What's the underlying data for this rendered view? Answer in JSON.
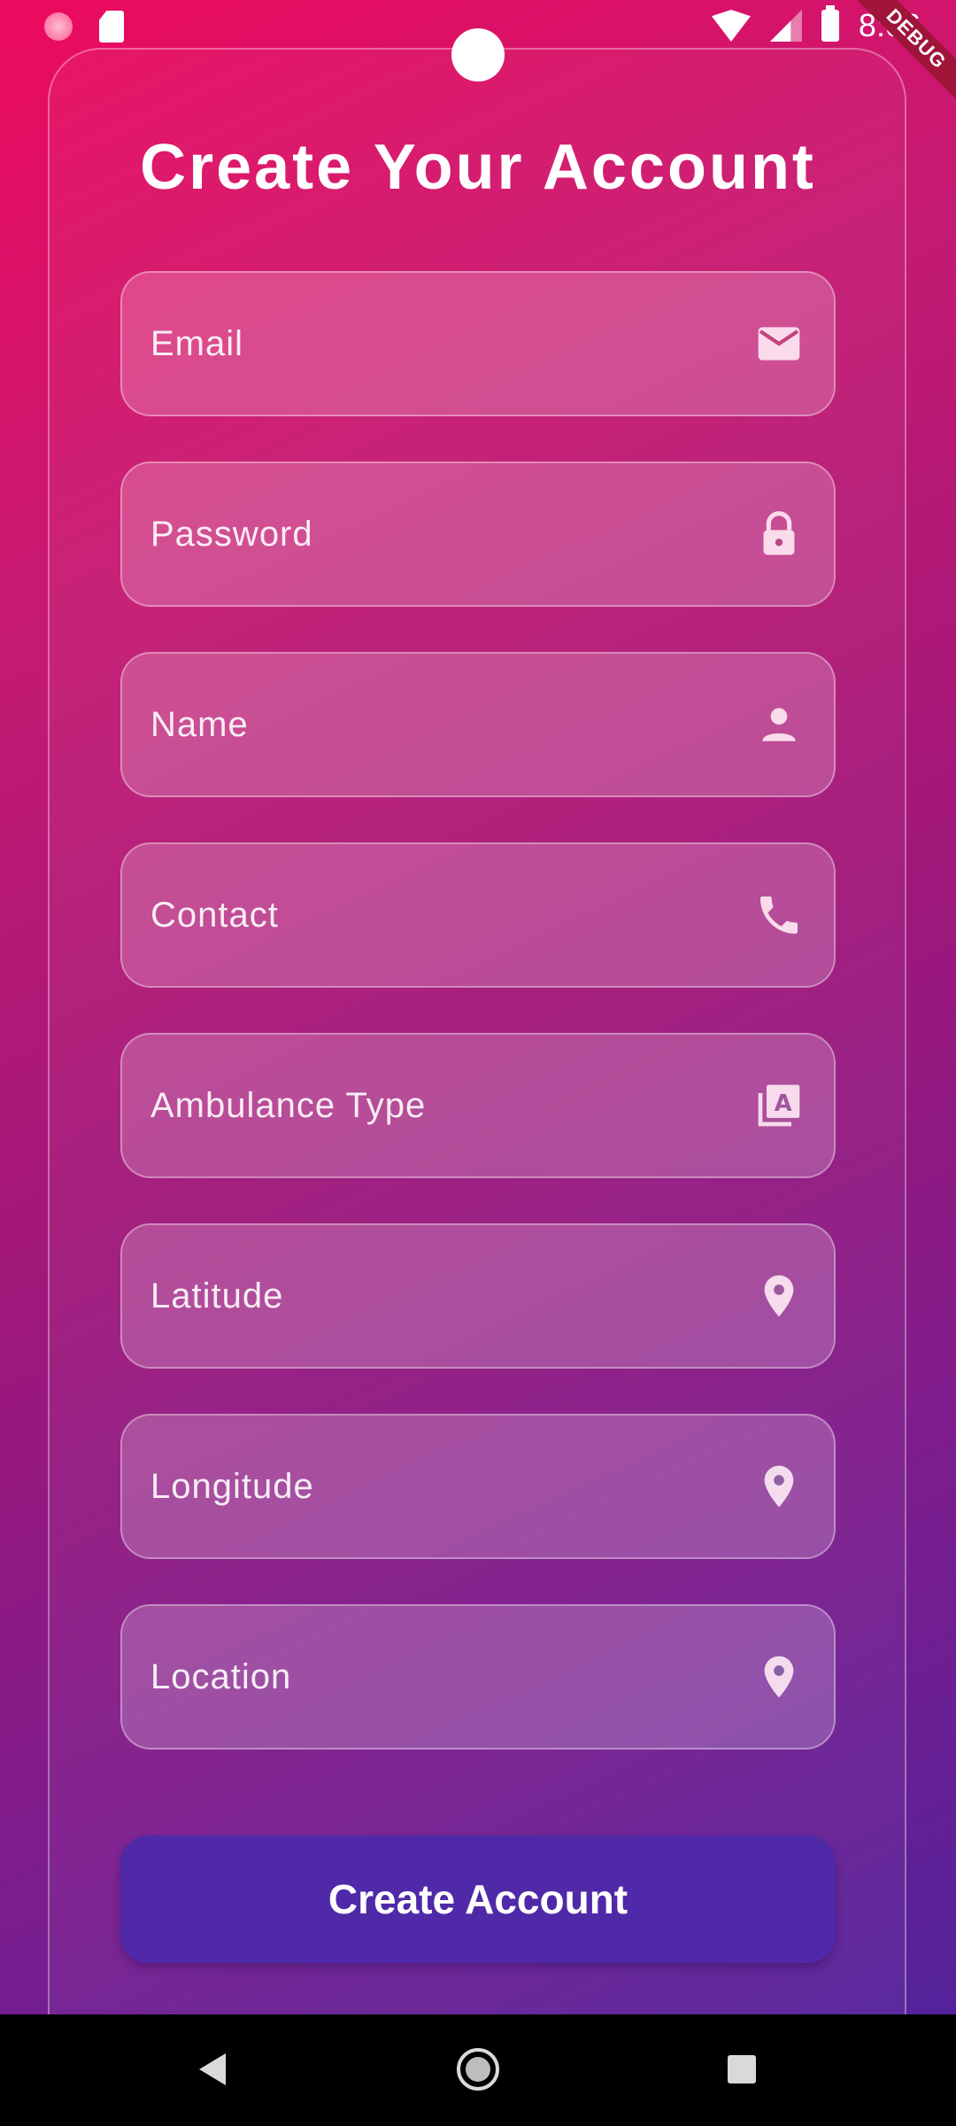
{
  "status_bar": {
    "time": "8:06",
    "debug_label": "DEBUG"
  },
  "form": {
    "title": "Create Your Account",
    "fields": [
      {
        "label": "Email",
        "icon": "mail-icon"
      },
      {
        "label": "Password",
        "icon": "lock-icon"
      },
      {
        "label": "Name",
        "icon": "person-icon"
      },
      {
        "label": "Contact",
        "icon": "phone-icon"
      },
      {
        "label": "Ambulance Type",
        "icon": "font-library-icon"
      },
      {
        "label": "Latitude",
        "icon": "location-pin-icon"
      },
      {
        "label": "Longitude",
        "icon": "location-pin-icon"
      },
      {
        "label": "Location",
        "icon": "location-pin-icon"
      }
    ],
    "submit_label": "Create Account"
  },
  "colors": {
    "gradient_start": "#ec0a5e",
    "gradient_end": "#4b249e",
    "button": "#5029a8"
  }
}
